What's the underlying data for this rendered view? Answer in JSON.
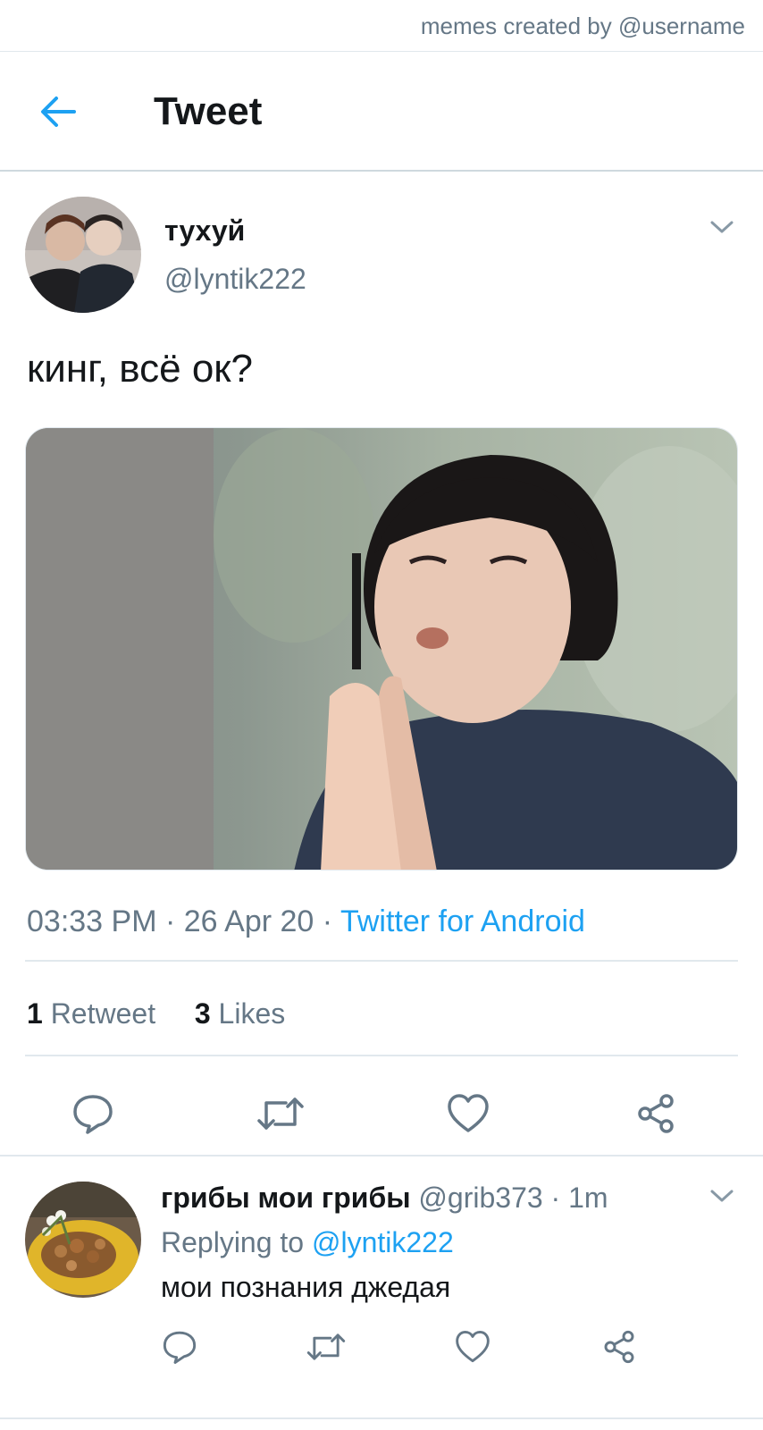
{
  "watermark": "memes created by @username",
  "header": {
    "title": "Tweet",
    "back_icon": "arrow-left-icon"
  },
  "tweet": {
    "display_name": "тухуй",
    "handle": "@lyntik222",
    "text": "кинг, всё ок?",
    "time": "03:33 PM",
    "date": "26 Apr 20",
    "source": "Twitter for Android",
    "retweets_count": "1",
    "retweets_label": "Retweet",
    "likes_count": "3",
    "likes_label": "Likes",
    "media_description": "gif still: man with eyes closed, hands pressed together, pencil behind ear",
    "actions": [
      "reply-icon",
      "retweet-icon",
      "like-icon",
      "share-icon"
    ]
  },
  "reply": {
    "display_name": "грибы мои грибы",
    "handle": "@grib373",
    "time": "1m",
    "replying_label": "Replying to",
    "replying_to": "@lyntik222",
    "text": "мои познания джедая"
  },
  "colors": {
    "accent": "#1da1f2",
    "muted": "#657786",
    "text": "#14171a",
    "divider": "#e1e8ed"
  }
}
